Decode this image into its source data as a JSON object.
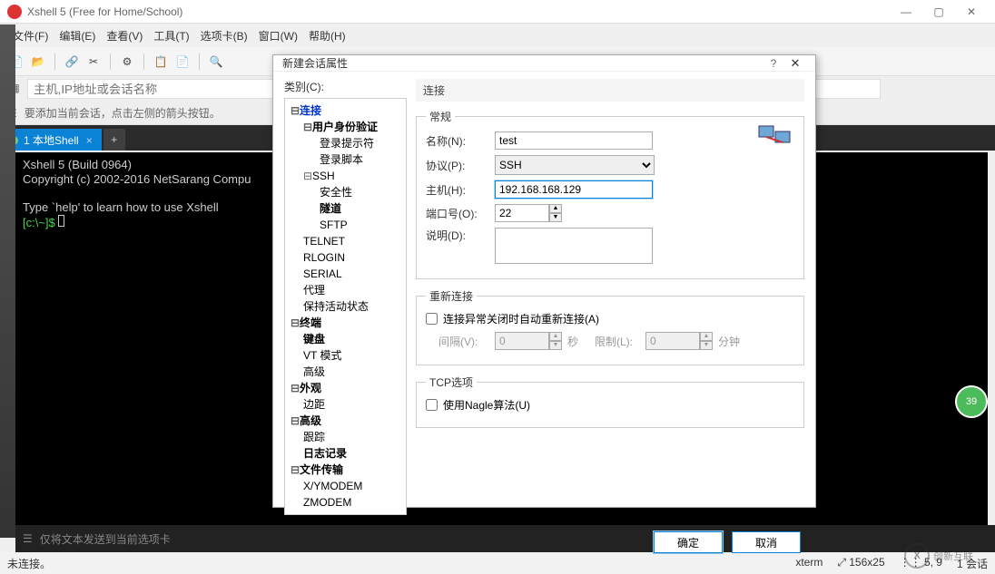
{
  "window": {
    "title": "Xshell 5 (Free for Home/School)"
  },
  "menubar": {
    "file": "文件(F)",
    "edit": "编辑(E)",
    "view": "查看(V)",
    "tools": "工具(T)",
    "tabs": "选项卡(B)",
    "window": "窗口(W)",
    "help": "帮助(H)"
  },
  "address": {
    "placeholder": "主机,IP地址或会话名称"
  },
  "hint": {
    "text": "要添加当前会话，点击左侧的箭头按钮。"
  },
  "tabs": {
    "active": "1 本地Shell"
  },
  "terminal": {
    "line1": "Xshell 5 (Build 0964)",
    "line2": "Copyright (c) 2002-2016 NetSarang Compu",
    "line3": "Type `help' to learn how to use Xshell",
    "prompt": "[c:\\~]$ "
  },
  "bottom_input": {
    "placeholder": "仅将文本发送到当前选项卡"
  },
  "statusbar": {
    "left": "未连接。",
    "term": "xterm",
    "size": "156x25",
    "pos": "5, 9",
    "sessions": "1 会话"
  },
  "dialog": {
    "title": "新建会话属性",
    "help": "?",
    "close": "✕",
    "category_label": "类别(C):",
    "tree": {
      "connection": "连接",
      "auth": "用户身份验证",
      "login_prompt": "登录提示符",
      "login_script": "登录脚本",
      "ssh": "SSH",
      "security": "安全性",
      "tunnel": "隧道",
      "sftp": "SFTP",
      "telnet": "TELNET",
      "rlogin": "RLOGIN",
      "serial": "SERIAL",
      "proxy": "代理",
      "keepalive": "保持活动状态",
      "terminal": "终端",
      "keyboard": "键盘",
      "vtmode": "VT 模式",
      "advanced_term": "高级",
      "appearance": "外观",
      "margin": "边距",
      "advanced": "高级",
      "trace": "跟踪",
      "logging": "日志记录",
      "file_transfer": "文件传输",
      "xymodem": "X/YMODEM",
      "zmodem": "ZMODEM"
    },
    "panel_title": "连接",
    "general": {
      "legend": "常规",
      "name_label": "名称(N):",
      "name_value": "test",
      "protocol_label": "协议(P):",
      "protocol_value": "SSH",
      "host_label": "主机(H):",
      "host_value": "192.168.168.129",
      "port_label": "端口号(O):",
      "port_value": "22",
      "desc_label": "说明(D):"
    },
    "reconnect": {
      "legend": "重新连接",
      "auto_label": "连接异常关闭时自动重新连接(A)",
      "interval_label": "间隔(V):",
      "interval_value": "0",
      "interval_unit": "秒",
      "limit_label": "限制(L):",
      "limit_value": "0",
      "limit_unit": "分钟"
    },
    "tcp": {
      "legend": "TCP选项",
      "nagle_label": "使用Nagle算法(U)"
    },
    "ok": "确定",
    "cancel": "取消"
  },
  "badge": {
    "text": "39"
  },
  "watermark": {
    "text": "创新互联"
  }
}
